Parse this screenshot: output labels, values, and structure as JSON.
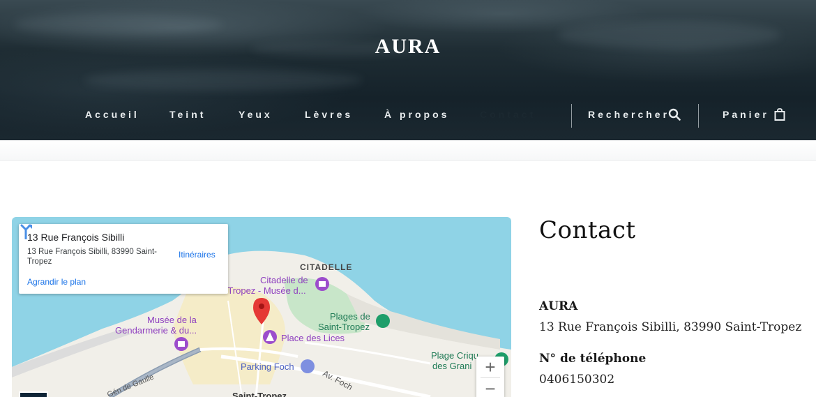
{
  "brand": {
    "name": "AURA"
  },
  "nav": {
    "items": [
      {
        "label": "Accueil"
      },
      {
        "label": "Teint"
      },
      {
        "label": "Yeux"
      },
      {
        "label": "Lèvres"
      },
      {
        "label": "À propos"
      },
      {
        "label": "Contact",
        "active": true
      }
    ],
    "search_label": "Rechercher",
    "search_icon": "search-icon",
    "cart_label": "Panier",
    "cart_icon": "shopping-bag-icon"
  },
  "map": {
    "info_card": {
      "title": "13 Rue François Sibilli",
      "address": "13 Rue François Sibilli, 83990 Saint-Tropez",
      "enlarge_link": "Agrandir le plan",
      "directions_label": "Itinéraires"
    },
    "labels": {
      "citadelle": "CITADELLE",
      "citadelle_museum_1": "Citadelle de",
      "citadelle_museum_2": "-Tropez - Musée d...",
      "plages_1": "Plages de",
      "plages_2": "Saint-Tropez",
      "musee_1": "Musée de la",
      "musee_2": "Gendarmerie & du...",
      "place_des_lices": "Place des Lices",
      "parking_foch": "Parking Foch",
      "av_foch": "Av. Foch",
      "gen_de_gaulle": "Gén de Gaulle",
      "plage_crique_1": "Plage Criqu",
      "plage_crique_2": "des Grani",
      "saint_tropez": "Saint-Tropez"
    },
    "zoom_in": "+",
    "zoom_out": "−"
  },
  "contact": {
    "title": "Contact",
    "company_label": "AURA",
    "address": "13 Rue François Sibilli, 83990 Saint-Tropez",
    "phone_label": "N° de téléphone",
    "phone": "0406150302"
  },
  "colors": {
    "header_dark": "#1b2830",
    "map_water": "#8fd3e6",
    "map_land": "#f1efe9",
    "map_park": "#c8e6c9",
    "pin_red": "#e53935",
    "poi_purple": "#9c4dcc",
    "link_blue": "#1a73e8"
  }
}
